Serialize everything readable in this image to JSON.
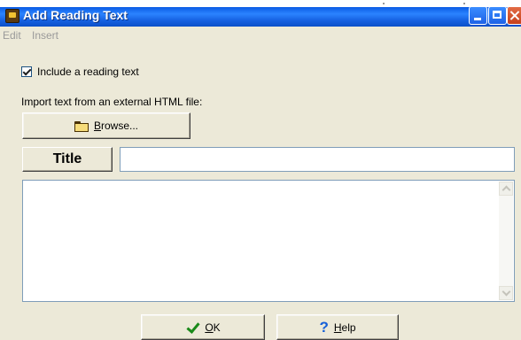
{
  "window": {
    "title": "Add Reading Text"
  },
  "menu": {
    "items": [
      "Edit",
      "Insert"
    ]
  },
  "checkbox": {
    "label": "Include a reading text",
    "checked": true
  },
  "import": {
    "label": "Import text from an external HTML file:",
    "browse_accel": "B",
    "browse_rest": "rowse..."
  },
  "title_field": {
    "label": "Title",
    "value": ""
  },
  "text_area": {
    "value": ""
  },
  "buttons": {
    "ok_accel": "O",
    "ok_rest": "K",
    "help_accel": "H",
    "help_rest": "elp"
  },
  "icons": {
    "app": "app-icon",
    "browse": "folder-icon",
    "ok": "check-icon",
    "help": "question-icon"
  },
  "colors": {
    "titlebar": "#2b83ff",
    "dialog_bg": "#ece9d8",
    "input_border": "#7f9db9"
  }
}
